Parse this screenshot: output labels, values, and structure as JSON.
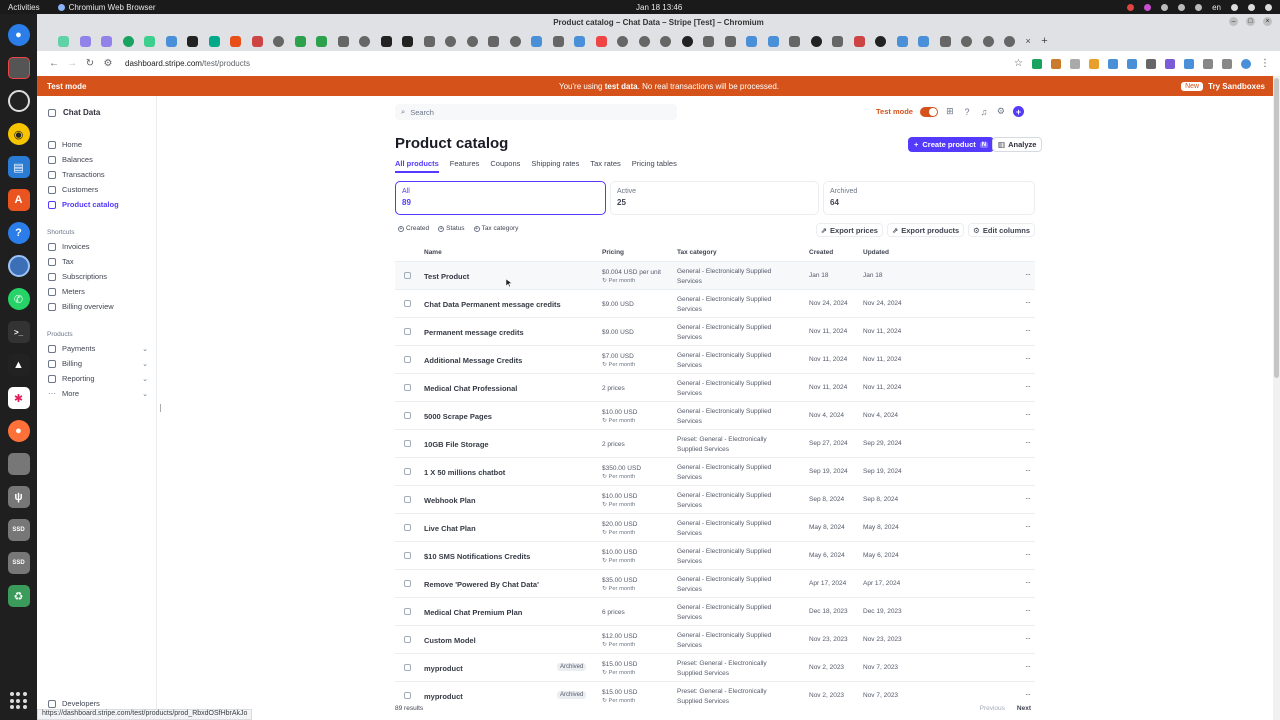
{
  "os": {
    "activities": "Activities",
    "app_name": "Chromium Web Browser",
    "clock": "Jan 18  13:46",
    "lang": "en"
  },
  "browser": {
    "window_title": "Product catalog – Chat Data – Stripe [Test] – Chromium",
    "url_host": "dashboard.stripe.com",
    "url_path": "/test/products",
    "status_url": "https://dashboard.stripe.com/test/products/prod_RbxdOSfHbrAkJo"
  },
  "banner": {
    "left": "Test mode",
    "msg_pre": "You're using ",
    "msg_bold": "test data",
    "msg_post": ". No real transactions will be processed.",
    "new_badge": "New",
    "sandboxes": "Try Sandboxes",
    "color": "#d5531b"
  },
  "sidebar": {
    "account": "Chat Data",
    "items": [
      {
        "label": "Home",
        "icon": "home-icon"
      },
      {
        "label": "Balances",
        "icon": "balance-icon"
      },
      {
        "label": "Transactions",
        "icon": "transactions-icon"
      },
      {
        "label": "Customers",
        "icon": "customers-icon"
      },
      {
        "label": "Product catalog",
        "icon": "product-icon"
      }
    ],
    "shortcuts_title": "Shortcuts",
    "shortcuts": [
      "Invoices",
      "Tax",
      "Subscriptions",
      "Meters",
      "Billing overview"
    ],
    "products_title": "Products",
    "products": [
      "Payments",
      "Billing",
      "Reporting",
      "More"
    ],
    "developers": "Developers"
  },
  "header": {
    "search_placeholder": "Search",
    "test_mode": "Test mode"
  },
  "page": {
    "title": "Product catalog",
    "create_btn": "Create product",
    "create_kbd": "N",
    "analyze_btn": "Analyze",
    "tabs": [
      "All products",
      "Features",
      "Coupons",
      "Shipping rates",
      "Tax rates",
      "Pricing tables"
    ],
    "filters": [
      {
        "label": "All",
        "count": "89"
      },
      {
        "label": "Active",
        "count": "25"
      },
      {
        "label": "Archived",
        "count": "64"
      }
    ],
    "chips": [
      "Created",
      "Status",
      "Tax category"
    ],
    "actions": [
      "Export prices",
      "Export products",
      "Edit columns"
    ],
    "columns": [
      "Name",
      "Pricing",
      "Tax category",
      "Created",
      "Updated"
    ],
    "results": "89 results",
    "prev": "Previous",
    "next": "Next",
    "accent": "#533afd"
  },
  "products": [
    {
      "name": "Test Product",
      "price": "$0.004 USD per unit",
      "per": "Per month",
      "tax1": "General - Electronically Supplied",
      "tax2": "Services",
      "created": "Jan 18",
      "updated": "Jan 18",
      "badge": ""
    },
    {
      "name": "Chat Data Permanent message credits",
      "price": "$9.00 USD",
      "per": "",
      "tax1": "General - Electronically Supplied",
      "tax2": "Services",
      "created": "Nov 24, 2024",
      "updated": "Nov 24, 2024",
      "badge": ""
    },
    {
      "name": "Permanent message credits",
      "price": "$9.00 USD",
      "per": "",
      "tax1": "General - Electronically Supplied",
      "tax2": "Services",
      "created": "Nov 11, 2024",
      "updated": "Nov 11, 2024",
      "badge": ""
    },
    {
      "name": "Additional Message Credits",
      "price": "$7.00 USD",
      "per": "Per month",
      "tax1": "General - Electronically Supplied",
      "tax2": "Services",
      "created": "Nov 11, 2024",
      "updated": "Nov 11, 2024",
      "badge": ""
    },
    {
      "name": "Medical Chat Professional",
      "price": "2 prices",
      "per": "",
      "tax1": "General - Electronically Supplied",
      "tax2": "Services",
      "created": "Nov 11, 2024",
      "updated": "Nov 11, 2024",
      "badge": ""
    },
    {
      "name": "5000 Scrape Pages",
      "price": "$10.00 USD",
      "per": "Per month",
      "tax1": "General - Electronically Supplied",
      "tax2": "Services",
      "created": "Nov 4, 2024",
      "updated": "Nov 4, 2024",
      "badge": ""
    },
    {
      "name": "10GB File Storage",
      "price": "2 prices",
      "per": "",
      "tax1": "Preset: General - Electronically",
      "tax2": "Supplied Services",
      "created": "Sep 27, 2024",
      "updated": "Sep 29, 2024",
      "badge": ""
    },
    {
      "name": "1 X 50 millions chatbot",
      "price": "$350.00 USD",
      "per": "Per month",
      "tax1": "General - Electronically Supplied",
      "tax2": "Services",
      "created": "Sep 19, 2024",
      "updated": "Sep 19, 2024",
      "badge": ""
    },
    {
      "name": "Webhook Plan",
      "price": "$10.00 USD",
      "per": "Per month",
      "tax1": "General - Electronically Supplied",
      "tax2": "Services",
      "created": "Sep 8, 2024",
      "updated": "Sep 8, 2024",
      "badge": ""
    },
    {
      "name": "Live Chat Plan",
      "price": "$20.00 USD",
      "per": "Per month",
      "tax1": "General - Electronically Supplied",
      "tax2": "Services",
      "created": "May 8, 2024",
      "updated": "May 8, 2024",
      "badge": ""
    },
    {
      "name": "$10 SMS Notifications Credits",
      "price": "$10.00 USD",
      "per": "Per month",
      "tax1": "General - Electronically Supplied",
      "tax2": "Services",
      "created": "May 6, 2024",
      "updated": "May 6, 2024",
      "badge": ""
    },
    {
      "name": "Remove 'Powered By Chat Data'",
      "price": "$35.00 USD",
      "per": "Per month",
      "tax1": "General - Electronically Supplied",
      "tax2": "Services",
      "created": "Apr 17, 2024",
      "updated": "Apr 17, 2024",
      "badge": ""
    },
    {
      "name": "Medical Chat Premium Plan",
      "price": "6 prices",
      "per": "",
      "tax1": "General - Electronically Supplied",
      "tax2": "Services",
      "created": "Dec 18, 2023",
      "updated": "Dec 19, 2023",
      "badge": ""
    },
    {
      "name": "Custom Model",
      "price": "$12.00 USD",
      "per": "Per month",
      "tax1": "General - Electronically Supplied",
      "tax2": "Services",
      "created": "Nov 23, 2023",
      "updated": "Nov 23, 2023",
      "badge": ""
    },
    {
      "name": "myproduct",
      "price": "$15.00 USD",
      "per": "Per month",
      "tax1": "Preset: General - Electronically",
      "tax2": "Supplied Services",
      "created": "Nov 2, 2023",
      "updated": "Nov 7, 2023",
      "badge": "Archived"
    },
    {
      "name": "myproduct",
      "price": "$15.00 USD",
      "per": "Per month",
      "tax1": "Preset: General - Electronically",
      "tax2": "Supplied Services",
      "created": "Nov 2, 2023",
      "updated": "Nov 7, 2023",
      "badge": "Archived"
    }
  ]
}
